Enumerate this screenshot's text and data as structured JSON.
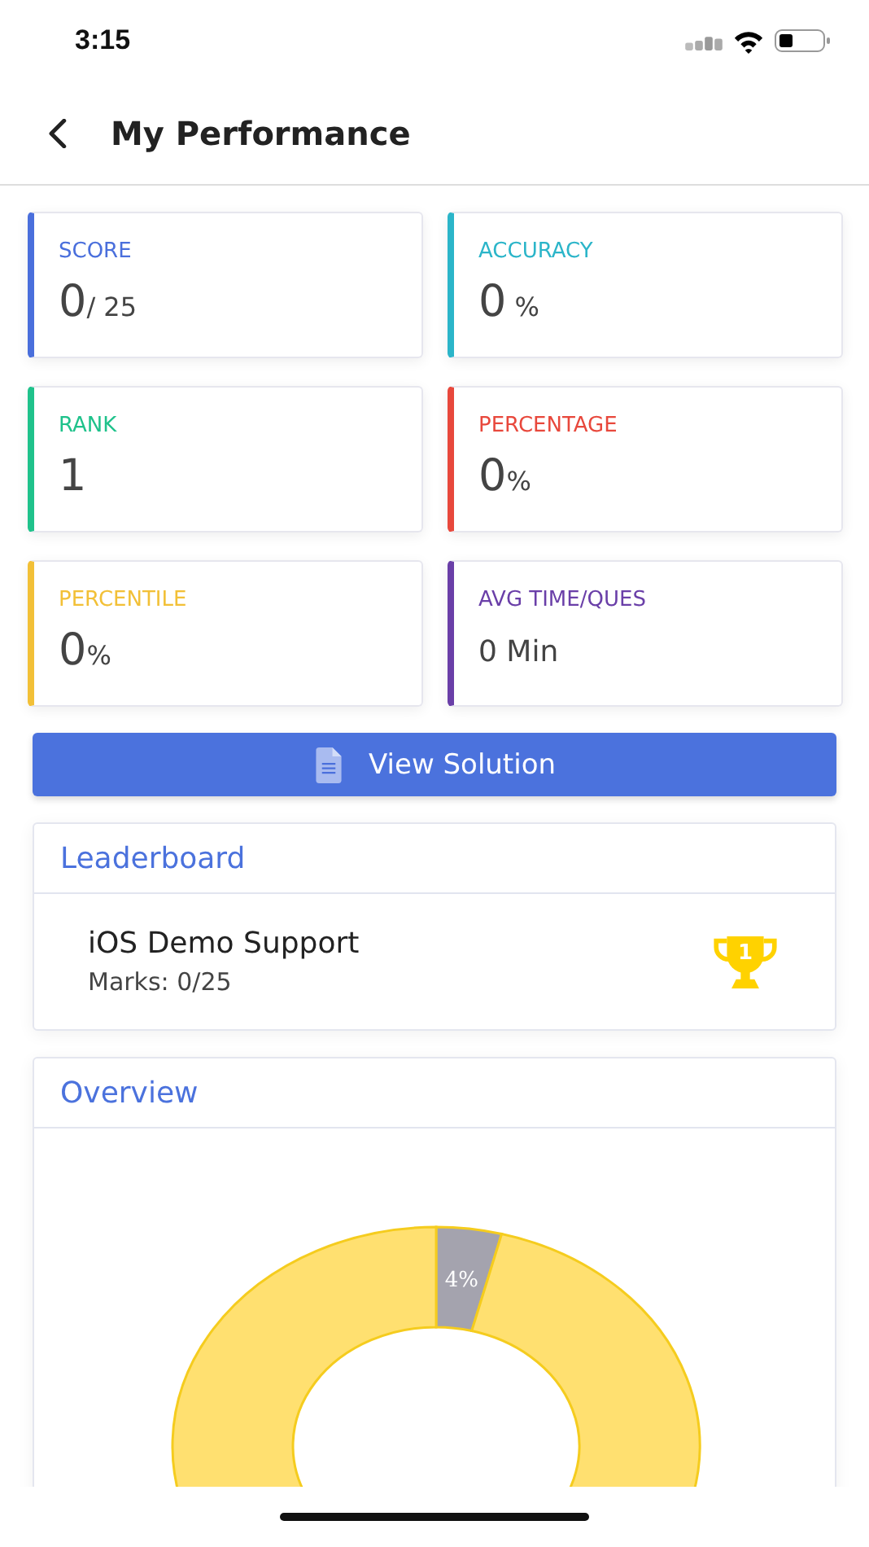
{
  "status_bar": {
    "time": "3:15"
  },
  "header": {
    "title": "My Performance"
  },
  "stats": [
    {
      "label": "SCORE",
      "value": "0",
      "unit": "/ 25",
      "color": "#4a6fdc"
    },
    {
      "label": "ACCURACY",
      "value": "0",
      "unit": " %",
      "color": "#2bb5c9"
    },
    {
      "label": "RANK",
      "value": "1",
      "color": "#1fc28b"
    },
    {
      "label": "PERCENTAGE",
      "value": "0",
      "unit": "%",
      "color": "#e8483c"
    },
    {
      "label": "PERCENTILE",
      "value": "0",
      "unit": "%",
      "color": "#f2c037"
    },
    {
      "label": "AVG TIME/QUES",
      "value": "0 Min",
      "color": "#6a3fa8"
    }
  ],
  "solution_button": {
    "label": "View Solution"
  },
  "leaderboard": {
    "title": "Leaderboard",
    "entries": [
      {
        "name": "iOS Demo Support",
        "marks": "Marks: 0/25",
        "rank": "1"
      }
    ]
  },
  "overview": {
    "title": "Overview",
    "slice_label": "4%"
  }
}
